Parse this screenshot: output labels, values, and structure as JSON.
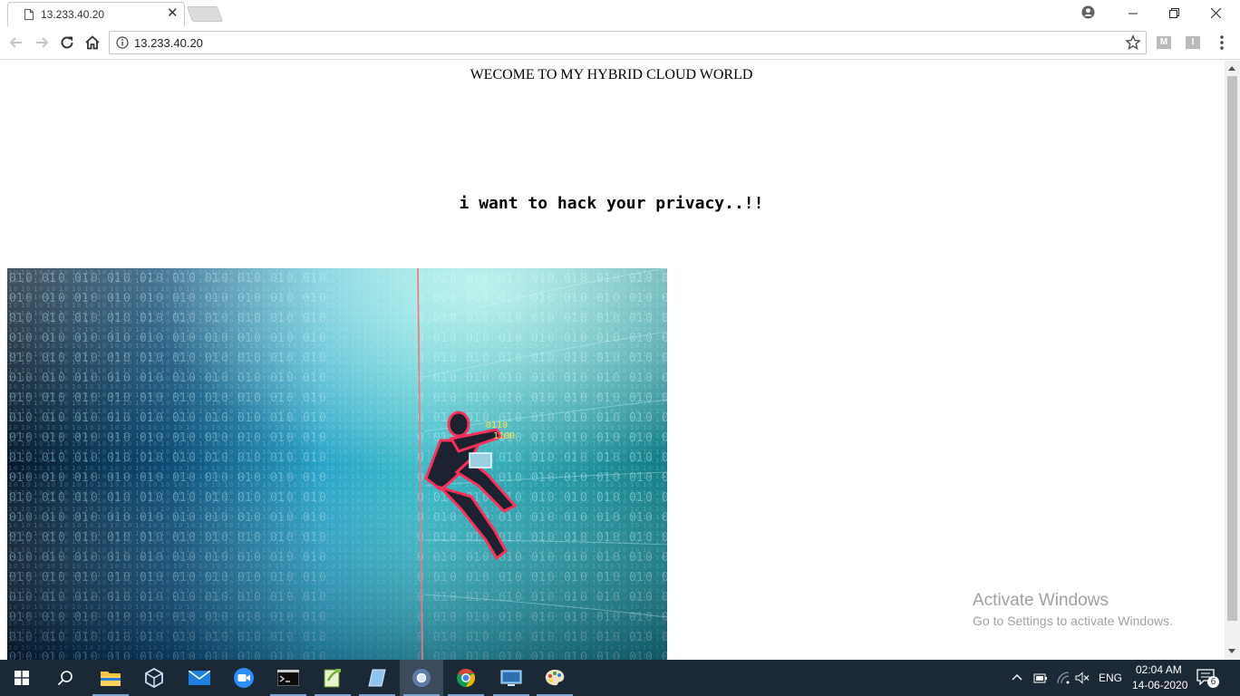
{
  "browser": {
    "tab": {
      "title": "13.233.40.20"
    },
    "address_bar": {
      "url": "13.233.40.20"
    },
    "extensions": [
      "M",
      "I"
    ]
  },
  "page": {
    "welcome_heading": "WECOME TO MY HYBRID CLOUD WORLD",
    "tagline": "i want to hack your privacy..!!",
    "image": {
      "description_icon": "hacker-climbing-binary-wall-image"
    }
  },
  "watermark": {
    "title": "Activate Windows",
    "subtitle": "Go to Settings to activate Windows."
  },
  "taskbar": {
    "items": [
      "start",
      "search",
      "file-explorer",
      "virtualbox",
      "mail",
      "zoom",
      "terminal",
      "notepad-plus",
      "editor",
      "chrome-alt",
      "chrome",
      "remote-desktop",
      "paint"
    ],
    "language": "ENG",
    "time": "02:04 AM",
    "date": "14-06-2020",
    "notification_count": "6"
  },
  "colors": {
    "taskbar": "#1b2836",
    "accent": "#7fa6d1"
  }
}
